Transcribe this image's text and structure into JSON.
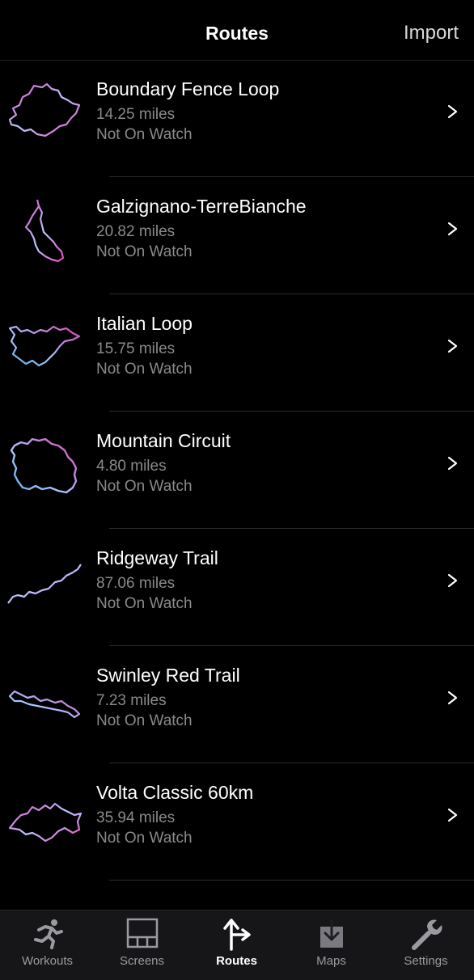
{
  "header": {
    "title": "Routes",
    "import_label": "Import"
  },
  "routes": [
    {
      "name": "Boundary Fence Loop",
      "distance": "14.25 miles",
      "status": "Not On Watch"
    },
    {
      "name": "Galzignano-TerreBianche",
      "distance": "20.82 miles",
      "status": "Not On Watch"
    },
    {
      "name": "Italian Loop",
      "distance": "15.75 miles",
      "status": "Not On Watch"
    },
    {
      "name": "Mountain Circuit",
      "distance": "4.80 miles",
      "status": "Not On Watch"
    },
    {
      "name": "Ridgeway Trail",
      "distance": "87.06 miles",
      "status": "Not On Watch"
    },
    {
      "name": "Swinley Red Trail",
      "distance": "7.23 miles",
      "status": "Not On Watch"
    },
    {
      "name": "Volta Classic 60km",
      "distance": "35.94 miles",
      "status": "Not On Watch"
    }
  ],
  "tabs": [
    {
      "label": "Workouts",
      "icon": "runner-icon"
    },
    {
      "label": "Screens",
      "icon": "screens-grid-icon"
    },
    {
      "label": "Routes",
      "icon": "route-arrows-icon",
      "active": true
    },
    {
      "label": "Maps",
      "icon": "map-download-icon"
    },
    {
      "label": "Settings",
      "icon": "wrench-icon"
    }
  ],
  "colors": {
    "background": "#000000",
    "route_pink": "#e040b0",
    "route_blue": "#9fc4ff",
    "tab_bar": "#161618"
  }
}
